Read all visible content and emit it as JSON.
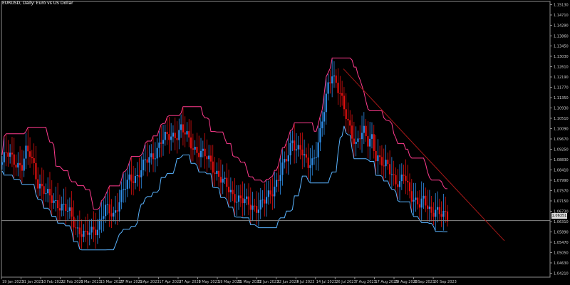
{
  "chart_data": {
    "type": "candlestick",
    "title": "EURUSD, Daily:  Euro vs US Dollar",
    "current_price": "1.06351",
    "y_ticks": [
      "1.15130",
      "1.14710",
      "1.14290",
      "1.13860",
      "1.13450",
      "1.13030",
      "1.12610",
      "1.12190",
      "1.11770",
      "1.11350",
      "1.10930",
      "1.10510",
      "1.10090",
      "1.09670",
      "1.09250",
      "1.08830",
      "1.08410",
      "1.07990",
      "1.07570",
      "1.07150",
      "1.06730",
      "1.06310",
      "1.05890",
      "1.05470",
      "1.05050",
      "1.04630",
      "1.04210"
    ],
    "ylim": [
      1.0405,
      1.1526
    ],
    "x_ticks": [
      "19 Jan 2023",
      "31 Jan 2023",
      "10 Feb 2023",
      "22 Feb 2023",
      "6 Mar 2023",
      "15 Mar 2023",
      "27 Mar 2023",
      "5 Apr 2023",
      "17 Apr 2023",
      "27 Apr 2023",
      "9 May 2023",
      "19 May 2023",
      "31 May 2023",
      "12 Jun 2023",
      "22 Jun 2023",
      "4 Jul 2023",
      "14 Jul 2023",
      "26 Jul 2023",
      "7 Aug 2023",
      "17 Aug 2023",
      "29 Aug 2023",
      "8 Sep 2023",
      "20 Sep 2023"
    ],
    "trend_line": {
      "start": [
        "14 Jul 2023",
        1.1252
      ],
      "end": [
        "Oct 2023",
        1.0553
      ]
    },
    "bullish_color": "#2f8ee8",
    "bearish_color": "#e01010",
    "upper_band_color": "#ff3b8d",
    "lower_band_color": "#5ab4ff",
    "trend_line_color": "#a81818",
    "price_line_color": "#8a8a8a"
  }
}
